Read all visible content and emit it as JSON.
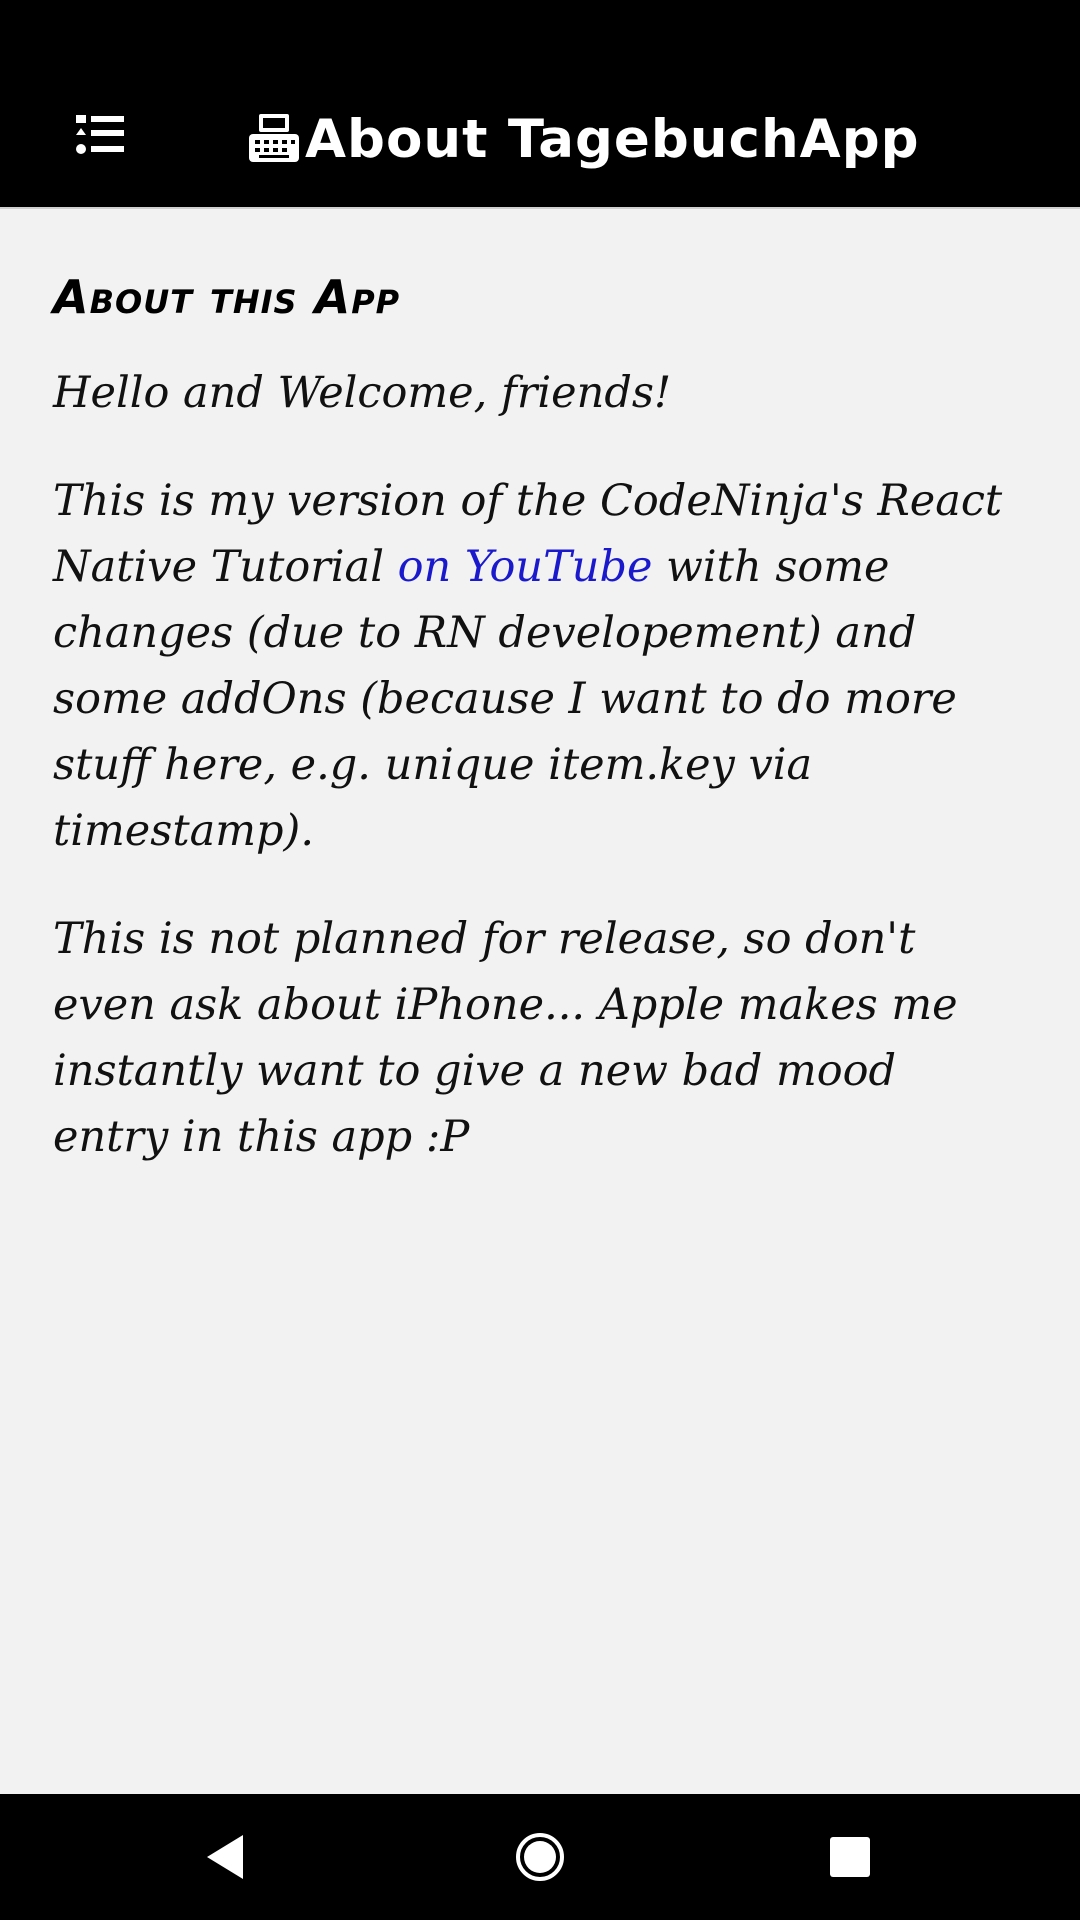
{
  "header": {
    "title": "About TagebuchApp",
    "menu_icon": "list-menu-icon",
    "title_icon": "typewriter-icon",
    "background": "#000000",
    "text_color": "#ffffff"
  },
  "content": {
    "heading": "About this App",
    "greeting": "Hello and Welcome, friends!",
    "paragraph2_before_link": "This is my version of the CodeNinja's React Native Tutorial ",
    "paragraph2_link": "on YouTube",
    "paragraph2_after_link": " with some changes (due to RN developement) and some addOns (because I want to do more stuff here, e.g. unique item.key via timestamp).",
    "paragraph3": "This is not planned for release, so don't even ask about iPhone... Apple makes me instantly want to give a new bad mood entry in this app :P",
    "link_color": "#1a1acc",
    "background": "#f2f2f2"
  },
  "navbar": {
    "back_icon": "back-triangle-icon",
    "home_icon": "home-circle-icon",
    "recents_icon": "recents-square-icon"
  }
}
